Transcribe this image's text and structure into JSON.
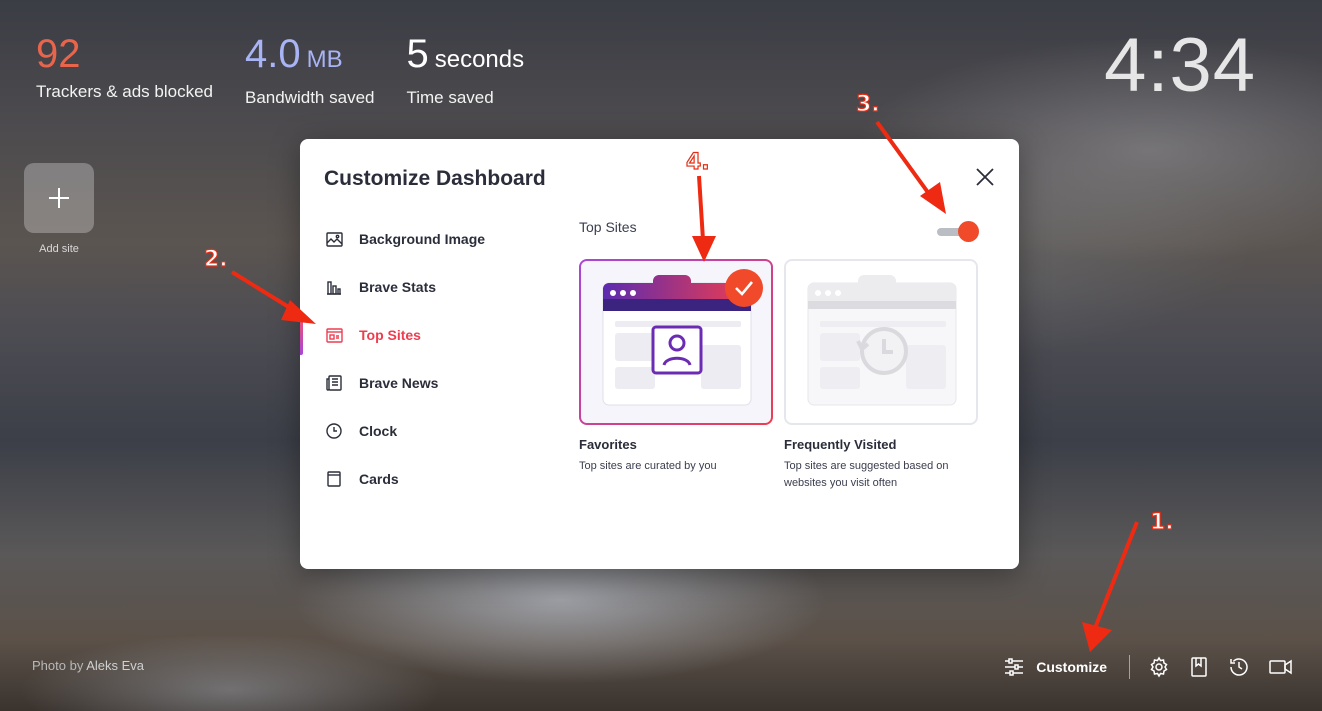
{
  "stats": {
    "trackers": {
      "value": "92",
      "unit": "",
      "label": "Trackers & ads blocked"
    },
    "bandwidth": {
      "value": "4.0",
      "unit": "MB",
      "label": "Bandwidth saved"
    },
    "time": {
      "value": "5",
      "unit": "seconds",
      "label": "Time saved"
    }
  },
  "clock": "4:34",
  "add_site": {
    "label": "Add site"
  },
  "photo_credit": {
    "prefix": "Photo by ",
    "author": "Aleks Eva"
  },
  "bottom_bar": {
    "customize_label": "Customize"
  },
  "modal": {
    "title": "Customize Dashboard",
    "nav": [
      {
        "label": "Background Image",
        "icon": "image-icon"
      },
      {
        "label": "Brave Stats",
        "icon": "bar-chart-icon"
      },
      {
        "label": "Top Sites",
        "icon": "top-sites-icon",
        "active": true
      },
      {
        "label": "Brave News",
        "icon": "news-icon"
      },
      {
        "label": "Clock",
        "icon": "clock-icon"
      },
      {
        "label": "Cards",
        "icon": "cards-icon"
      }
    ],
    "section_title": "Top Sites",
    "toggle_on": true,
    "options": [
      {
        "name": "Favorites",
        "desc": "Top sites are curated by you",
        "selected": true
      },
      {
        "name": "Frequently Visited",
        "desc": "Top sites are suggested based on websites you visit often",
        "selected": false
      }
    ]
  },
  "annotations": [
    "1.",
    "2.",
    "3.",
    "4."
  ],
  "colors": {
    "accent": "#ee3d4f",
    "toggle": "#f04a2a",
    "purple": "#a846d9",
    "trackers": "#e8654c",
    "bandwidth": "#a9b4f5"
  }
}
